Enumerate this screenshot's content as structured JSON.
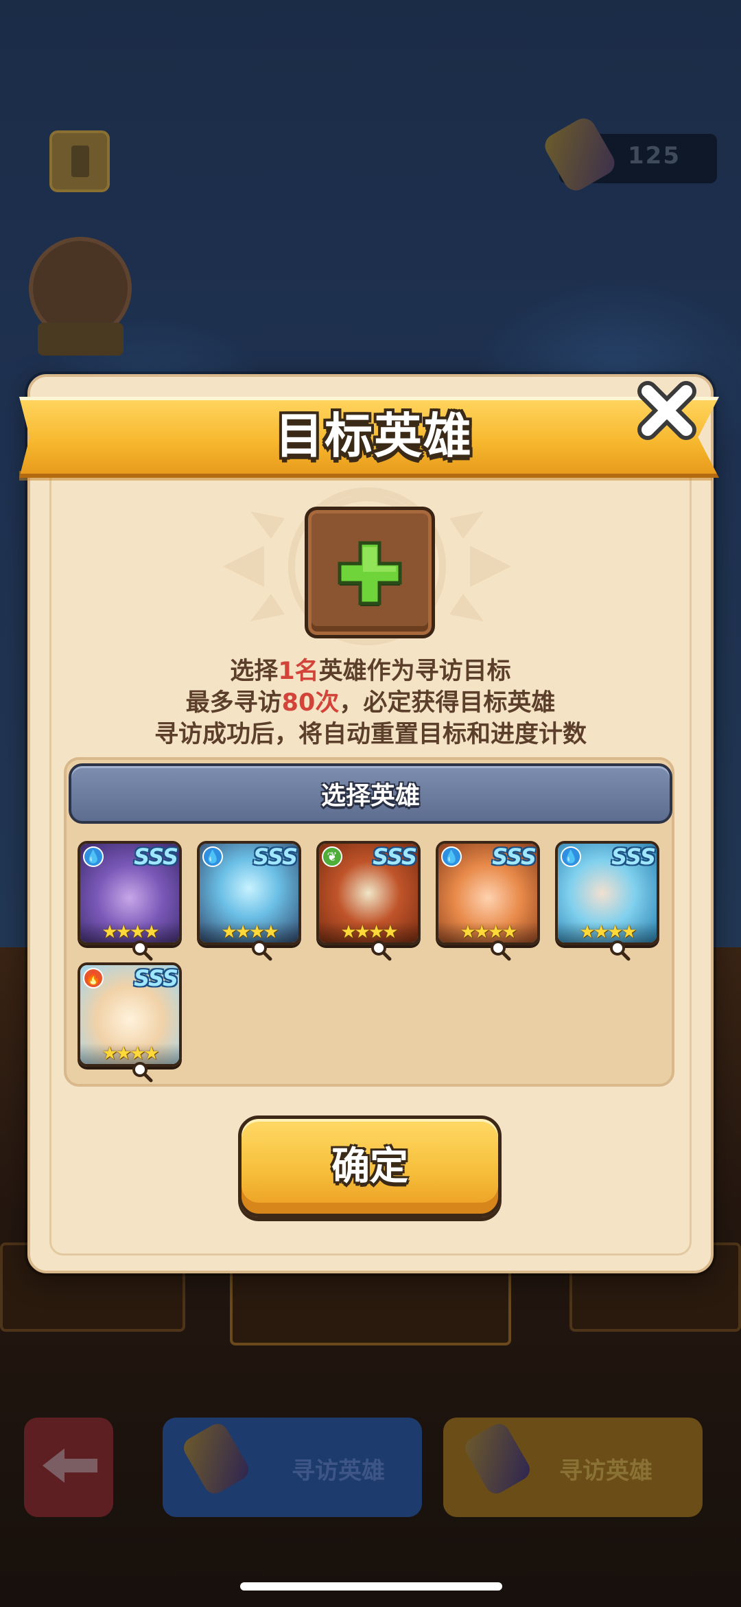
{
  "background": {
    "currency_value": "125",
    "left_button_label": "寻访英雄",
    "right_button_label": "寻访英雄"
  },
  "modal": {
    "title": "目标英雄",
    "close_icon": "close-icon",
    "add_slot_icon": "plus-icon",
    "info_lines": [
      {
        "pre": "选择",
        "highlight": "1名",
        "post": "英雄作为寻访目标"
      },
      {
        "pre": "最多寻访",
        "highlight": "80次",
        "post": "，必定获得目标英雄"
      },
      {
        "pre": "寻访成功后，将自动重置目标和进度计数",
        "highlight": "",
        "post": ""
      }
    ],
    "hero_list": {
      "header": "选择英雄",
      "heroes": [
        {
          "name": "hero-1",
          "element": "water",
          "rank": "SSS",
          "stars": "★★★★"
        },
        {
          "name": "hero-2",
          "element": "water",
          "rank": "SSS",
          "stars": "★★★★"
        },
        {
          "name": "hero-3",
          "element": "nature",
          "rank": "SSS",
          "stars": "★★★★"
        },
        {
          "name": "hero-4",
          "element": "water",
          "rank": "SSS",
          "stars": "★★★★"
        },
        {
          "name": "hero-5",
          "element": "water",
          "rank": "SSS",
          "stars": "★★★★"
        },
        {
          "name": "hero-6",
          "element": "fire",
          "rank": "SSS",
          "stars": "★★★★"
        }
      ]
    },
    "confirm_label": "确定"
  },
  "colors": {
    "highlight": "#d2443a",
    "banner": "#f7b92f",
    "panel_header": "#5d6d8f",
    "water": "#2f8fe0",
    "nature": "#4fae3a",
    "fire": "#e8552a"
  }
}
